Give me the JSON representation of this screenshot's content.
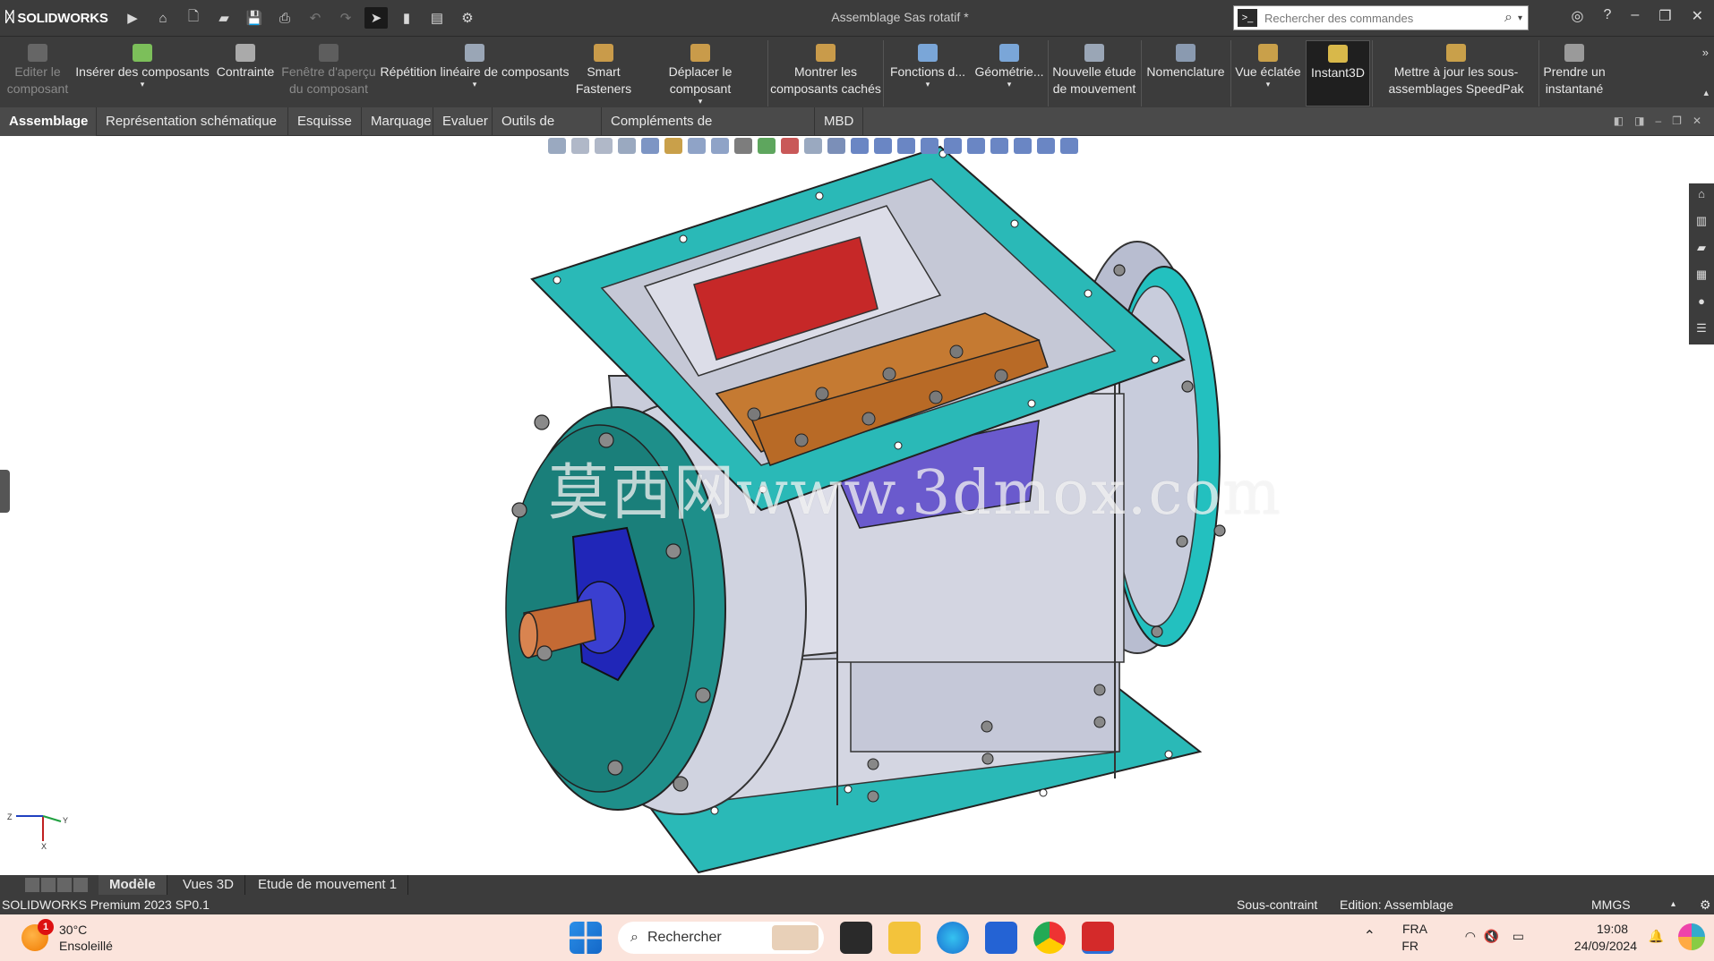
{
  "app": {
    "brand": "SOLIDWORKS",
    "doc_title": "Assemblage Sas rotatif *"
  },
  "search": {
    "placeholder": "Rechercher des commandes"
  },
  "ribbon": {
    "edit_component": "Editer le composant",
    "insert_components": "Insérer des composants",
    "mate": "Contrainte",
    "component_preview": "Fenêtre d'aperçu du composant",
    "linear_pattern": "Répétition linéaire de composants",
    "smart_fasteners": "Smart Fasteners",
    "move_component": "Déplacer le composant",
    "show_hidden": "Montrer les composants cachés",
    "functions": "Fonctions d...",
    "geometry": "Géométrie...",
    "new_motion_study": "Nouvelle étude de mouvement",
    "bom": "Nomenclature",
    "exploded_view": "Vue éclatée",
    "instant3d": "Instant3D",
    "update_speedpak": "Mettre à jour les sous-assemblages SpeedPak",
    "snapshot": "Prendre un instantané"
  },
  "tabs": [
    "Assemblage",
    "Représentation schématique",
    "Esquisse",
    "Marquage",
    "Evaluer",
    "Outils de rendu",
    "Compléments de SOLIDWORKS",
    "MBD"
  ],
  "active_tab": "Assemblage",
  "watermark": "莫西网www.3dmox.com",
  "bottom_tabs": [
    "Modèle",
    "Vues 3D",
    "Etude de mouvement 1"
  ],
  "status": {
    "product": "SOLIDWORKS Premium 2023 SP0.1",
    "constraint": "Sous-contraint",
    "edit": "Edition: Assemblage",
    "units": "MMGS"
  },
  "taskbar": {
    "temp": "30°C",
    "weather": "Ensoleillé",
    "weather_badge": "1",
    "search": "Rechercher",
    "lang1": "FRA",
    "lang2": "FR",
    "time": "19:08",
    "date": "24/09/2024"
  }
}
